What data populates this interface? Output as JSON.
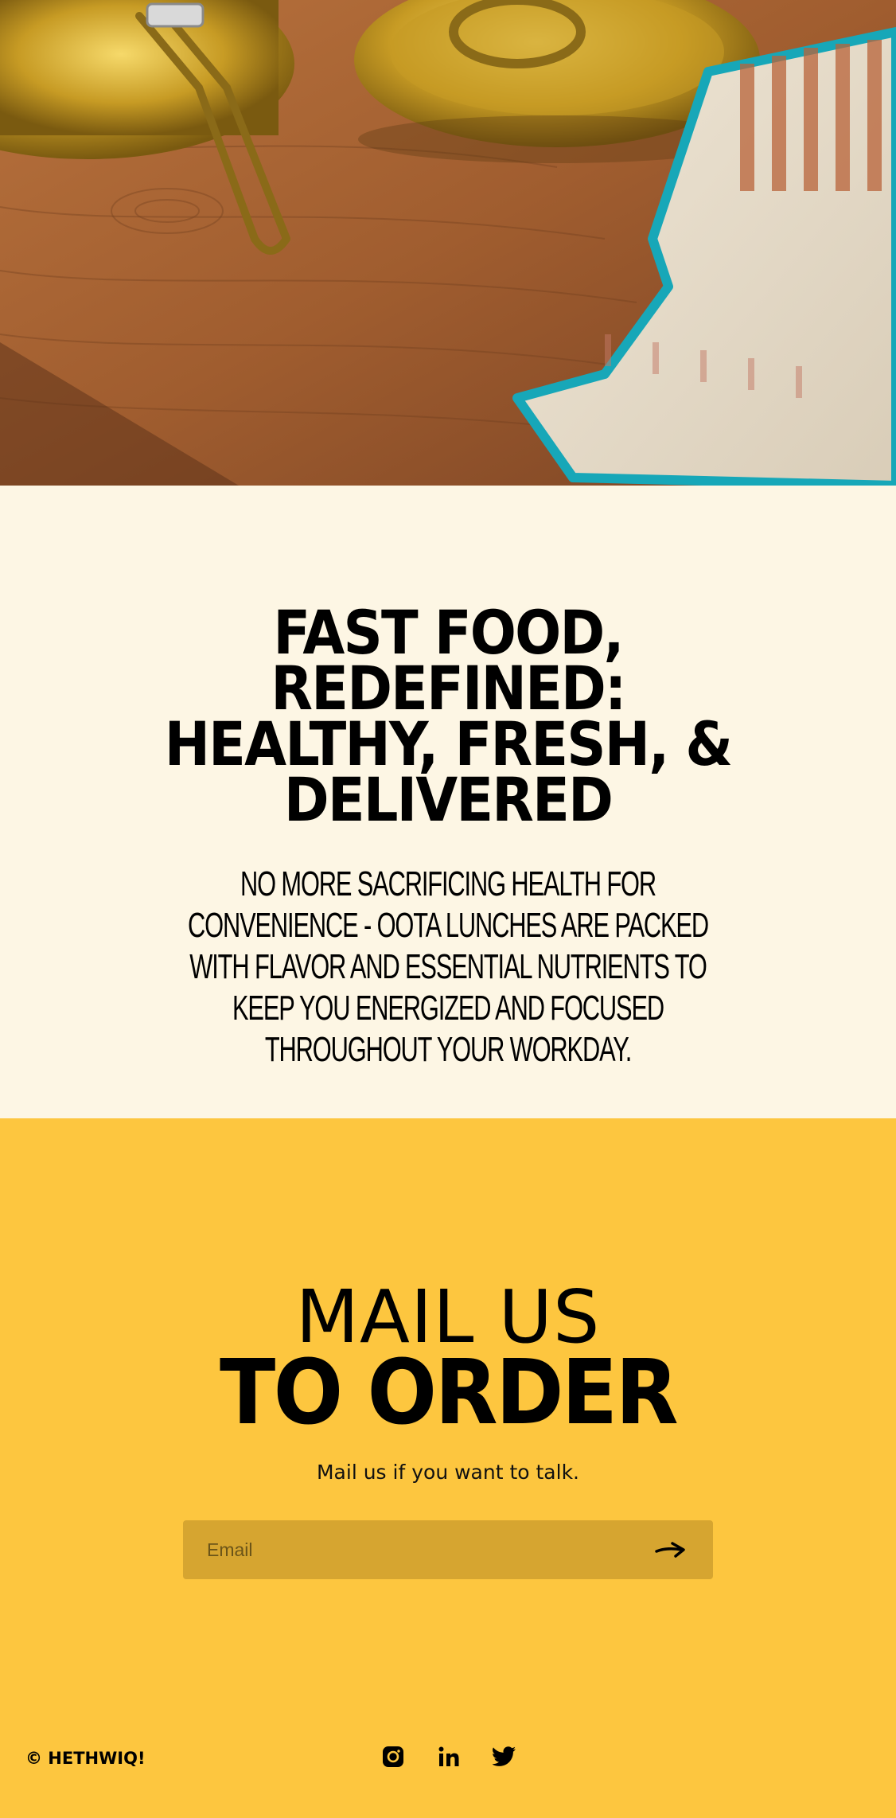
{
  "hero": {
    "image_alt": ""
  },
  "intro": {
    "title_lines": [
      "FAST FOOD,",
      "REDEFINED:",
      "HEALTHY, FRESH, &",
      "DELIVERED"
    ],
    "body": "NO MORE SACRIFICING HEALTH FOR CONVENIENCE - OOTA LUNCHES ARE PACKED WITH FLAVOR AND ESSENTIAL NUTRIENTS TO KEEP YOU ENERGIZED AND FOCUSED THROUGHOUT YOUR WORKDAY."
  },
  "mail": {
    "title_line1": "MAIL US",
    "title_line2": "TO ORDER",
    "subtitle": "Mail us if you want to talk.",
    "email_placeholder": "Email",
    "submit_icon": "arrow-right-icon"
  },
  "footer": {
    "copyright": "© HETHWIQ!",
    "socials": [
      {
        "name": "instagram-icon"
      },
      {
        "name": "linkedin-icon"
      },
      {
        "name": "twitter-icon"
      }
    ]
  },
  "colors": {
    "cream": "#FDF6E4",
    "yellow": "#FDC63F",
    "input_bg": "#D6A530",
    "text": "#000000"
  }
}
